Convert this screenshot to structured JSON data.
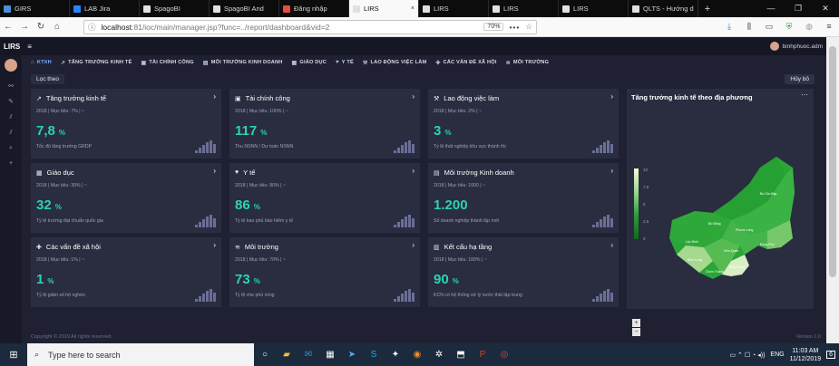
{
  "browser": {
    "tabs": [
      {
        "label": "GIRS",
        "color": "#4a90d9"
      },
      {
        "label": "LAB Jira",
        "color": "#2684ff"
      },
      {
        "label": "SpagoBI",
        "color": "#e0e0e0"
      },
      {
        "label": "SpagoBI And",
        "color": "#e0e0e0"
      },
      {
        "label": "Đăng nhập",
        "color": "#e94b3c"
      },
      {
        "label": "LIRS",
        "color": "#e0e0e0",
        "active": true
      },
      {
        "label": "LIRS",
        "color": "#e0e0e0"
      },
      {
        "label": "LIRS",
        "color": "#e0e0e0"
      },
      {
        "label": "LIRS",
        "color": "#e0e0e0"
      },
      {
        "label": "QLTS - Hướng d",
        "color": "#e0e0e0"
      }
    ],
    "tab_close": "×",
    "new_tab": "+",
    "window_controls": [
      "—",
      "❐",
      "✕"
    ],
    "url_host": "localhost",
    "url_path": ":81/ioc/main/manager.jsp?func=../report/dashboard&vid=2",
    "zoom": "70%",
    "url_more": "•••"
  },
  "app": {
    "logo": "LIRS",
    "user": "binhphuoc.adm",
    "menu": [
      {
        "label": "KTXH",
        "icon": "⌂",
        "active": true
      },
      {
        "label": "TĂNG TRƯỞNG KINH TẾ",
        "icon": "↗"
      },
      {
        "label": "TÀI CHÍNH CÔNG",
        "icon": "▣"
      },
      {
        "label": "MÔI TRƯỜNG KINH DOANH",
        "icon": "▤"
      },
      {
        "label": "GIÁO DỤC",
        "icon": "▦"
      },
      {
        "label": "Y TẾ",
        "icon": "♥"
      },
      {
        "label": "LAO ĐỘNG VIỆC LÀM",
        "icon": "⚒"
      },
      {
        "label": "CÁC VẤN ĐỀ XÃ HỘI",
        "icon": "✚"
      },
      {
        "label": "MÔI TRƯỜNG",
        "icon": "≋"
      }
    ],
    "filter_label": "Lọc theo",
    "cancel_label": "Hủy bỏ",
    "cards": [
      {
        "title": "Tăng trưởng kinh tế",
        "icon": "↗",
        "meta": "2018 | Mục tiêu: 7% | ~",
        "value": "7,8",
        "unit": "%",
        "desc": "Tốc độ tăng trưởng GRDP"
      },
      {
        "title": "Tài chính công",
        "icon": "▣",
        "meta": "2018 | Mục tiêu: 100% | ~",
        "value": "117",
        "unit": "%",
        "desc": "Thu NSNN / Dự toán NSNN"
      },
      {
        "title": "Lao động việc làm",
        "icon": "⚒",
        "meta": "2018 | Mục tiêu: 2% | ~",
        "value": "3",
        "unit": "%",
        "desc": "Tỷ lệ thất nghiệp khu vực thành thị"
      },
      {
        "title": "Giáo dục",
        "icon": "▦",
        "meta": "2018 | Mục tiêu: 30% | ~",
        "value": "32",
        "unit": "%",
        "desc": "Tỷ lệ trường đạt chuẩn quốc gia"
      },
      {
        "title": "Y tế",
        "icon": "♥",
        "meta": "2018 | Mục tiêu: 80% | ~",
        "value": "86",
        "unit": "%",
        "desc": "Tỷ lệ bao phủ bảo hiểm y tế"
      },
      {
        "title": "Môi trường Kinh doanh",
        "icon": "▤",
        "meta": "2018 | Mục tiêu: 1000 | ~",
        "value": "1.200",
        "unit": "",
        "desc": "Số doanh nghiệp thành lập mới"
      },
      {
        "title": "Các vấn đề xã hội",
        "icon": "✚",
        "meta": "2018 | Mục tiêu: 1% | ~",
        "value": "1",
        "unit": "%",
        "desc": "Tỷ lệ giảm số hộ nghèo"
      },
      {
        "title": "Môi trường",
        "icon": "≋",
        "meta": "2018 | Mục tiêu: 70% | ~",
        "value": "73",
        "unit": "%",
        "desc": "Tỷ lệ che phủ rừng"
      },
      {
        "title": "Kết cấu hạ tầng",
        "icon": "▥",
        "meta": "2018 | Mục tiêu: 100% | ~",
        "value": "90",
        "unit": "%",
        "desc": "KCN có hệ thống xử lý nước thải tập trung"
      }
    ],
    "map": {
      "title": "Tăng trưởng kinh tế theo địa phương",
      "more": "···",
      "legend_ticks": [
        "10",
        "7,5",
        "5",
        "2,5",
        "0"
      ],
      "zoom_in": "+",
      "zoom_out": "−",
      "region_labels": [
        "Bù Đăng",
        "Phước Long",
        "Lộc Ninh",
        "Bù Gia Mập",
        "Bình Long",
        "Đồng Xoài",
        "Chơn Thành",
        "Đồng Phú",
        "Hớn Quản"
      ]
    },
    "footer": "Copyright © 2019 All rights reserved.",
    "version": "Version 1.0"
  },
  "taskbar": {
    "search_placeholder": "Type here to search",
    "lang": "ENG",
    "time": "11:03 AM",
    "date": "11/12/2019",
    "notif": "6"
  }
}
